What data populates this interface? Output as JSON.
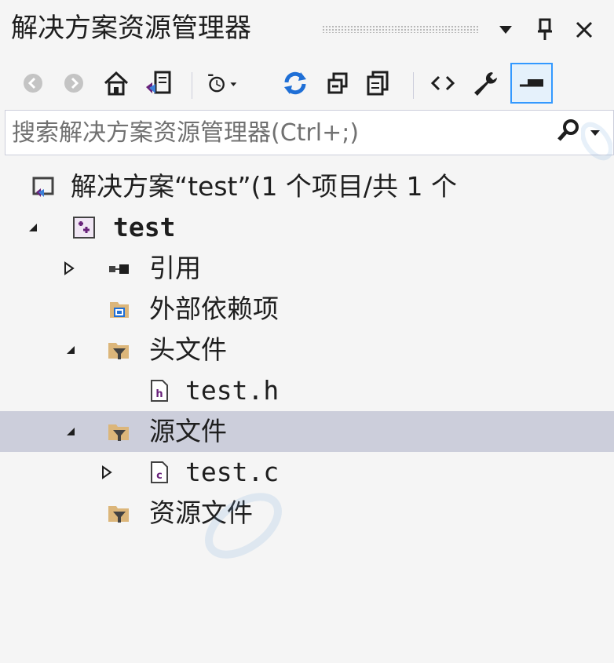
{
  "window": {
    "title": "解决方案资源管理器"
  },
  "titlebar_buttons": {
    "dropdown_icon": "chevron-down-icon",
    "pin_icon": "pin-icon",
    "close_icon": "close-icon"
  },
  "toolbar": {
    "items": [
      {
        "name": "back-icon"
      },
      {
        "name": "forward-icon"
      },
      {
        "name": "home-icon"
      },
      {
        "name": "switch-views-icon"
      },
      {
        "name": "pending-changes-filter-icon"
      },
      {
        "name": "sync-icon"
      },
      {
        "name": "collapse-all-icon"
      },
      {
        "name": "show-all-files-icon"
      },
      {
        "name": "view-code-icon"
      },
      {
        "name": "properties-icon"
      },
      {
        "name": "preview-selected-items-icon"
      }
    ]
  },
  "search": {
    "placeholder": "搜索解决方案资源管理器(Ctrl+;)"
  },
  "tree": {
    "solution": "解决方案“test”(1 个项目/共 1 个",
    "project": "test",
    "references": "引用",
    "external_deps": "外部依赖项",
    "header_files": "头文件",
    "header_file_1": "test.h",
    "source_files": "源文件",
    "source_file_1": "test.c",
    "resource_files": "资源文件"
  },
  "colors": {
    "background": "#f5f5f5",
    "selection": "#cccedb",
    "accent_blue": "#3399ff",
    "vs_purple": "#68217a",
    "folder_tan": "#dcb67a"
  }
}
